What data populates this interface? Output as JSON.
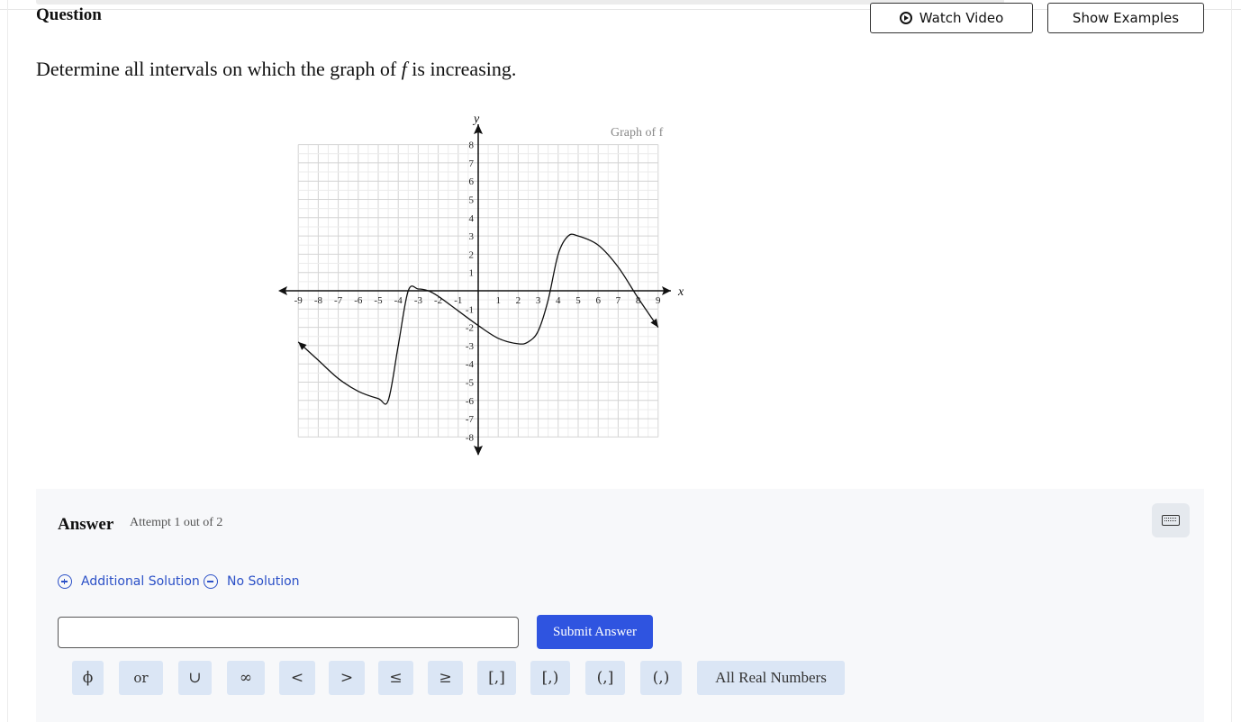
{
  "header": {
    "question_label": "Question",
    "watch_video_label": "Watch Video",
    "show_examples_label": "Show Examples"
  },
  "question": {
    "prompt_before": "Determine all intervals on which the graph of ",
    "prompt_var": "f",
    "prompt_after": " is increasing."
  },
  "graph": {
    "title": "Graph of f",
    "x_axis_label": "x",
    "y_axis_label": "y"
  },
  "chart_data": {
    "type": "line",
    "title": "Graph of f",
    "xlabel": "x",
    "ylabel": "y",
    "xlim": [
      -9,
      9
    ],
    "ylim": [
      -8,
      8
    ],
    "grid": true,
    "x_ticks": [
      "-9",
      "-8",
      "-7",
      "-6",
      "-5",
      "-4",
      "-3",
      "-2",
      "-1",
      "1",
      "2",
      "3",
      "4",
      "5",
      "6",
      "7",
      "8",
      "9"
    ],
    "y_ticks": [
      "8",
      "7",
      "6",
      "5",
      "4",
      "3",
      "2",
      "1",
      "-1",
      "-2",
      "-3",
      "-4",
      "-5",
      "-6",
      "-7",
      "-8"
    ],
    "series": [
      {
        "x": [
          -9,
          -8,
          -7,
          -6,
          -5,
          -4.5,
          -4,
          -3.5,
          -3,
          -2.5,
          -2,
          -1,
          0,
          1,
          2,
          2.5,
          3,
          3.5,
          4,
          4.5,
          5,
          6,
          7,
          8,
          9
        ],
        "y": [
          -2.8,
          -3.8,
          -4.8,
          -5.5,
          -5.9,
          -6,
          -3,
          0,
          0.1,
          0,
          -0.3,
          -1.1,
          -1.9,
          -2.6,
          -2.9,
          -2.8,
          -2.2,
          -0.5,
          2,
          3,
          3,
          2.5,
          1.3,
          -0.4,
          -2
        ]
      }
    ]
  },
  "answer": {
    "title": "Answer",
    "attempt": "Attempt 1 out of 2",
    "additional_solution": "Additional Solution",
    "no_solution": "No Solution",
    "input_value": "",
    "submit_label": "Submit Answer"
  },
  "symbols": [
    "ϕ",
    "or",
    "∪",
    "∞",
    "<",
    ">",
    "≤",
    "≥",
    "[,]",
    "[,)",
    "(,]",
    "(,)",
    "All Real Numbers"
  ]
}
